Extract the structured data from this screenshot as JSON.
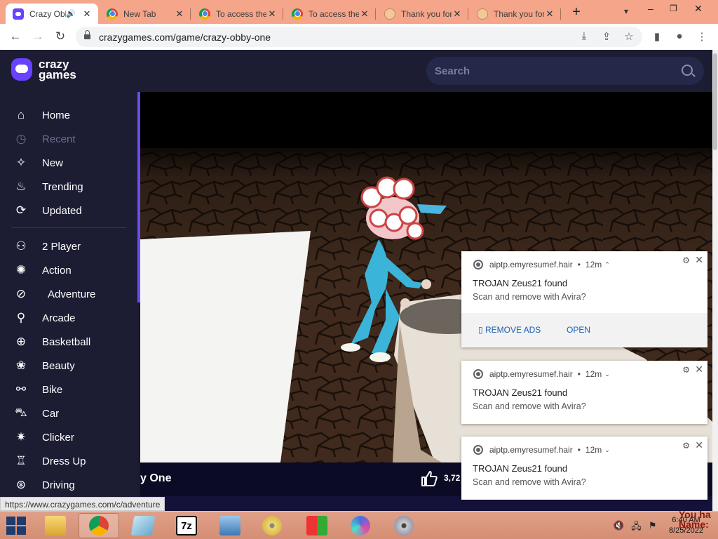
{
  "browser": {
    "tabs": [
      {
        "title": "Crazy Obby One - Play Online for Free | CrazyGames",
        "icon": "crazygames-favicon",
        "active": true,
        "audio": true
      },
      {
        "title": "New Tab",
        "icon": "chrome-favicon",
        "active": false
      },
      {
        "title": "To access the",
        "icon": "chrome-favicon",
        "active": false
      },
      {
        "title": "To access the",
        "icon": "chrome-favicon",
        "active": false
      },
      {
        "title": "Thank you for",
        "icon": "cookie-favicon",
        "active": false
      },
      {
        "title": "Thank you for",
        "icon": "cookie-favicon",
        "active": false
      }
    ],
    "url": "crazygames.com/game/crazy-obby-one",
    "status_url": "https://www.crazygames.com/c/adventure"
  },
  "site": {
    "logo_line1": "crazy",
    "logo_line2": "games",
    "search_placeholder": "Search"
  },
  "sidebar": {
    "items": [
      {
        "label": "Home",
        "icon": "home-icon",
        "dim": false
      },
      {
        "label": "Recent",
        "icon": "clock-icon",
        "dim": true
      },
      {
        "label": "New",
        "icon": "sparkle-icon",
        "dim": false
      },
      {
        "label": "Trending",
        "icon": "flame-icon",
        "dim": false
      },
      {
        "label": "Updated",
        "icon": "refresh-icon",
        "dim": false
      },
      {
        "label": "2 Player",
        "icon": "two-player-icon",
        "dim": false
      },
      {
        "label": "Action",
        "icon": "action-icon",
        "dim": false
      },
      {
        "label": "Adventure",
        "icon": "compass-icon",
        "dim": false
      },
      {
        "label": "Arcade",
        "icon": "joystick-icon",
        "dim": false
      },
      {
        "label": "Basketball",
        "icon": "basketball-icon",
        "dim": false
      },
      {
        "label": "Beauty",
        "icon": "flower-icon",
        "dim": false
      },
      {
        "label": "Bike",
        "icon": "bike-icon",
        "dim": false
      },
      {
        "label": "Car",
        "icon": "car-icon",
        "dim": false
      },
      {
        "label": "Clicker",
        "icon": "clicker-icon",
        "dim": false
      },
      {
        "label": "Dress Up",
        "icon": "dress-icon",
        "dim": false
      },
      {
        "label": "Driving",
        "icon": "steering-wheel-icon",
        "dim": false
      }
    ]
  },
  "game": {
    "title_visible": "y One",
    "likes_visible": "3,72"
  },
  "notifications": [
    {
      "source": "aiptp.emyresumef.hair",
      "age": "12m",
      "title": "TROJAN Zeus21 found",
      "message": "Scan and remove with Avira?",
      "expanded": true,
      "remove_ads_label": "REMOVE ADS",
      "open_label": "OPEN"
    },
    {
      "source": "aiptp.emyresumef.hair",
      "age": "12m",
      "title": "TROJAN Zeus21 found",
      "message": "Scan and remove with Avira?",
      "expanded": false
    },
    {
      "source": "aiptp.emyresumef.hair",
      "age": "12m",
      "title": "TROJAN Zeus21 found",
      "message": "Scan and remove with Avira?",
      "expanded": false
    }
  ],
  "taskbar": {
    "apps": [
      "file-explorer-icon",
      "chrome-icon",
      "notepad-icon",
      "7zip-icon",
      "control-panel-icon",
      "cd-icon",
      "windows-app-icon",
      "media-player-icon",
      "dvd-icon"
    ],
    "time": "6:40 AM",
    "date": "8/25/2022",
    "corner_text_1": "You ha",
    "corner_text_2": "Name:"
  },
  "colors": {
    "accent": "#6842ff",
    "site_bg": "#1c1d33",
    "tabstrip": "#f4a58a"
  }
}
